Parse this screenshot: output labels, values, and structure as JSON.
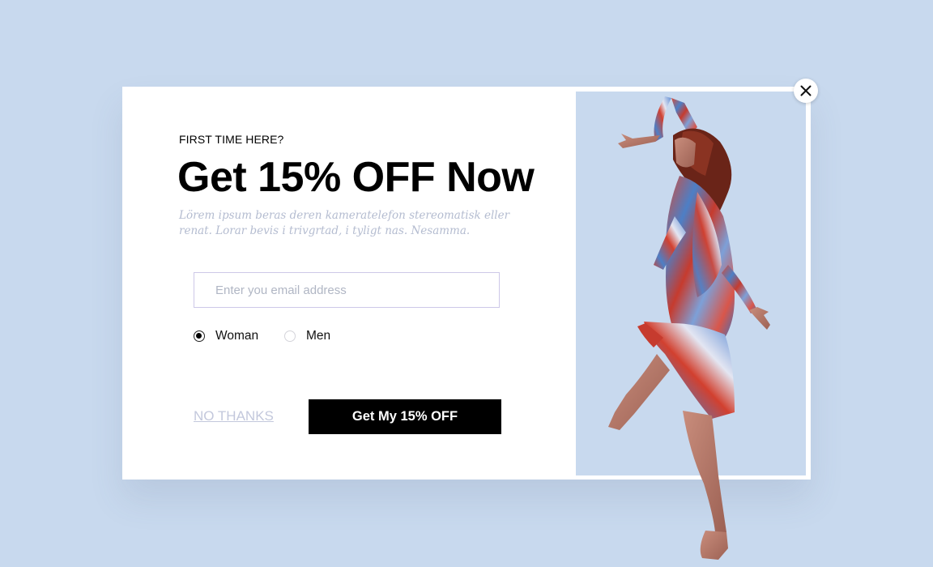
{
  "popup": {
    "eyebrow": "FIRST TIME HERE?",
    "headline": "Get 15% OFF Now",
    "description": "Lörem ipsum beras deren kameratelefon stereomatisk eller renat. Lorar bevis i trivgrtad, i tyligt nas. Nesamma.",
    "email_placeholder": "Enter you email address",
    "email_value": "",
    "gender_options": [
      {
        "label": "Woman",
        "selected": true
      },
      {
        "label": "Men",
        "selected": false
      }
    ],
    "no_thanks_label": "NO THANKS",
    "cta_label": "Get My 15% OFF",
    "close_icon": "close-icon"
  },
  "colors": {
    "page_background": "#c8d9ee",
    "modal_background": "#ffffff",
    "cta_background": "#000000",
    "cta_text": "#ffffff",
    "muted_text": "#c3c8dc",
    "input_border": "#cdc8e8"
  }
}
